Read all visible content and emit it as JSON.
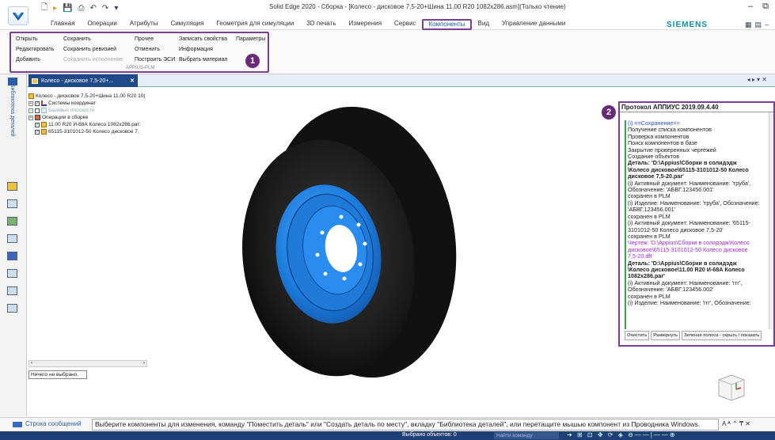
{
  "window": {
    "title": "Solid Edge 2020 - Сборка - [Колесо - дисковое 7,5-20+Шина 11.00 R20 1082x286.asm](Только чтение)",
    "controls": [
      "–",
      "⧉"
    ]
  },
  "ribbon_tabs": [
    "Главная",
    "Операции",
    "Атрибуты",
    "Симуляция",
    "Геометрия для симуляции",
    "3D печать",
    "Измерения",
    "Сервис",
    "Компоненты",
    "Вид",
    "Управление данными"
  ],
  "active_tab": "Компоненты",
  "brand": "SIEMENS",
  "ribbon": {
    "col1": [
      "Открыть",
      "Редактировать",
      "Добавить"
    ],
    "col2": [
      "Сохранить",
      "Сохранить ревизией",
      "Сохранить исполнение"
    ],
    "col3": [
      "Прочее",
      "Отменить",
      "Построить ЭСИ"
    ],
    "col4": [
      "Записать свойства",
      "Информация",
      "Выбрать материал"
    ],
    "col5": [
      "Параметры"
    ],
    "group_label": "APPIUS-PLM",
    "callout": "1"
  },
  "left_strip": {
    "label": "Библиотека деталей"
  },
  "doc_tab": {
    "label": "Колесо - дисковое 7,5-20+...",
    "close": "✕",
    "nav": "◂ ▸ ▾ ✕"
  },
  "tree": {
    "root": "Колесо - дисковое 7,5-20+Шина 11.00 R20 10(",
    "items": [
      {
        "label": "Системы координат"
      },
      {
        "label": "Базовые плоскости"
      },
      {
        "label": "Операции в сборке"
      },
      {
        "label": "11.00 R20 И-68А Колесо 1082x286.par:"
      },
      {
        "label": "65115-3101012-50 Колесо дисковое 7,"
      }
    ],
    "status": "Ничего не выбрано."
  },
  "protocol": {
    "title": "Протокол АППИУС 2019.09.4.40",
    "callout": "2",
    "lines": [
      {
        "text": "(i) ==Сохранение==",
        "style": "blue"
      },
      {
        "text": "Получение списка компонентов",
        "style": ""
      },
      {
        "text": "Проверка компонентов",
        "style": ""
      },
      {
        "text": "Поиск компонентов в базе",
        "style": ""
      },
      {
        "text": "Закрытие проверенных чертежей",
        "style": ""
      },
      {
        "text": "Создание объектов",
        "style": ""
      },
      {
        "text": "  Деталь: 'D:\\Appius\\Сборки в солидэдж",
        "style": "bold"
      },
      {
        "text": "\\Колесо дисковое\\65115-3101012-50 Колесо",
        "style": "bold"
      },
      {
        "text": "дисковое 7,5-20.par'",
        "style": "bold"
      },
      {
        "text": "(i) Активный документ: Наименование: 'труба',",
        "style": ""
      },
      {
        "text": "Обозначение: 'АБВГ.123456.001'",
        "style": ""
      },
      {
        "text": "  сохранен в PLM",
        "style": ""
      },
      {
        "text": "(i) Изделие: Наименование: 'труба', Обозначение:",
        "style": ""
      },
      {
        "text": "'АБВГ.123456.001'",
        "style": ""
      },
      {
        "text": "  сохранен в PLM",
        "style": ""
      },
      {
        "text": "(i) Активный документ: Наименование: '65115-",
        "style": ""
      },
      {
        "text": "3101012-50 Колесо дисковое 7,5-20'",
        "style": ""
      },
      {
        "text": "  сохранен в PLM",
        "style": ""
      },
      {
        "text": "Чертеж: 'D:\\Appius\\Сборки в солидэдж\\Колесо",
        "style": "purple"
      },
      {
        "text": "дисковое\\65115-3101012-50 Колесо дисковое",
        "style": "purple"
      },
      {
        "text": "7,5-20.dft'",
        "style": "purple"
      },
      {
        "text": "  Деталь: 'D:\\Appius\\Сборки в солидэдж",
        "style": "bold"
      },
      {
        "text": "\\Колесо дисковое\\11.00 R20 И-68А Колесо",
        "style": "bold"
      },
      {
        "text": "1082x286.par'",
        "style": "bold"
      },
      {
        "text": "(i) Активный документ: Наименование: 'ггг',",
        "style": ""
      },
      {
        "text": "Обозначение: 'АБВГ.123456.002'",
        "style": ""
      },
      {
        "text": "  сохранен в PLM",
        "style": ""
      },
      {
        "text": "(i) Изделие: Наименование: 'ггг', Обозначение:",
        "style": ""
      }
    ],
    "buttons": [
      "Очистить",
      "Развернуть",
      "Зеленая полоса - скрыть / показать"
    ]
  },
  "message_bar": {
    "label": "Строка сообщений",
    "text": "Выберите компоненты для изменения, команду \"Поместить деталь\" или \"Создать деталь по месту\", вкладку \"Библиотека деталей\", или перетащите мышью компонент из Проводника Windows."
  },
  "status_bar": {
    "selected": "Выбрано объектов: 0",
    "search_placeholder": "Найти команду"
  },
  "colors": {
    "callout": "#6a2a7a",
    "rim": "#1e7fe0",
    "tire": "#1a1a1a",
    "statusbar": "#1f3f77"
  }
}
